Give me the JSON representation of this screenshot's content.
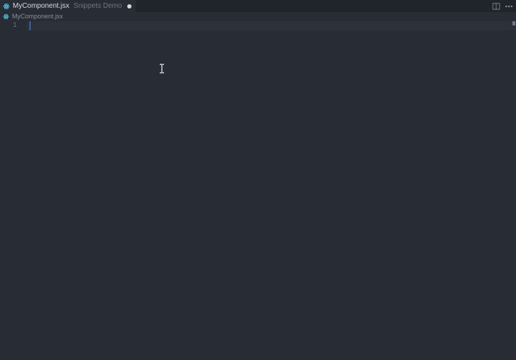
{
  "tab": {
    "title": "MyComponent.jsx",
    "subtitle": "Snippets Demo",
    "dirty": true
  },
  "breadcrumb": {
    "file": "MyComponent.jsx"
  },
  "editor": {
    "lineNumbers": [
      "1"
    ],
    "content": ""
  },
  "colors": {
    "bg": "#282c34",
    "tabBarBg": "#21252b",
    "accent": "#528bff",
    "reactIcon": "#61dafb"
  }
}
